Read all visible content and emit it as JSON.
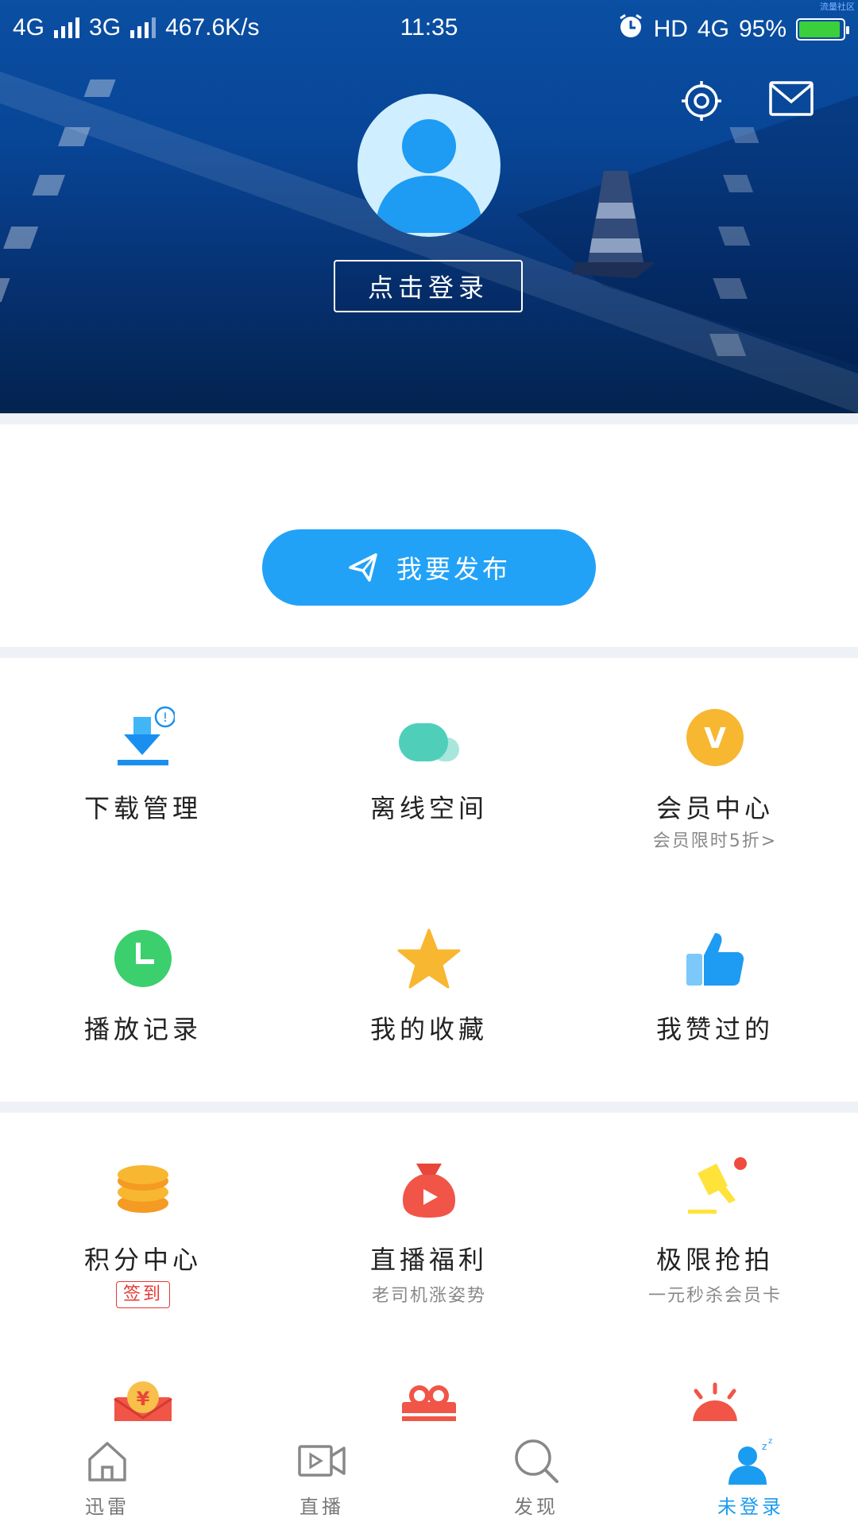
{
  "status_bar": {
    "network1": "4G",
    "network2": "3G",
    "speed": "467.6K/s",
    "time": "11:35",
    "hd": "HD",
    "network3": "4G",
    "battery": "95%",
    "battery_level": 0.95,
    "watermark": "流量社区"
  },
  "header": {
    "login_label": "点击登录"
  },
  "publish": {
    "label": "我要发布"
  },
  "grid1": [
    {
      "label": "下载管理",
      "icon": "download-icon",
      "badge": "!"
    },
    {
      "label": "离线空间",
      "icon": "cloud-icon"
    },
    {
      "label": "会员中心",
      "icon": "vip-icon",
      "sub": "会员限时5折>",
      "icon_text": "V"
    },
    {
      "label": "播放记录",
      "icon": "clock-icon"
    },
    {
      "label": "我的收藏",
      "icon": "star-icon"
    },
    {
      "label": "我赞过的",
      "icon": "thumbs-up-icon"
    }
  ],
  "grid2": [
    {
      "label": "积分中心",
      "icon": "coins-icon",
      "tag": "签到"
    },
    {
      "label": "直播福利",
      "icon": "money-bag-icon",
      "sub": "老司机涨姿势"
    },
    {
      "label": "极限抢拍",
      "icon": "auction-hammer-icon",
      "sub": "一元秒杀会员卡"
    },
    {
      "label": "",
      "icon": "red-envelope-icon",
      "icon_text": "¥"
    },
    {
      "label": "",
      "icon": "gift-icon"
    },
    {
      "label": "",
      "icon": "alarm-light-icon"
    }
  ],
  "tabbar": [
    {
      "label": "迅雷",
      "icon": "home-icon",
      "active": false
    },
    {
      "label": "直播",
      "icon": "video-icon",
      "active": false
    },
    {
      "label": "发现",
      "icon": "search-icon",
      "active": false
    },
    {
      "label": "未登录",
      "icon": "user-icon",
      "active": true
    }
  ],
  "colors": {
    "accent": "#22a2f7",
    "header_dark": "#03234f",
    "header_light": "#0a4fa3",
    "active_tab": "#1a9cf0"
  }
}
